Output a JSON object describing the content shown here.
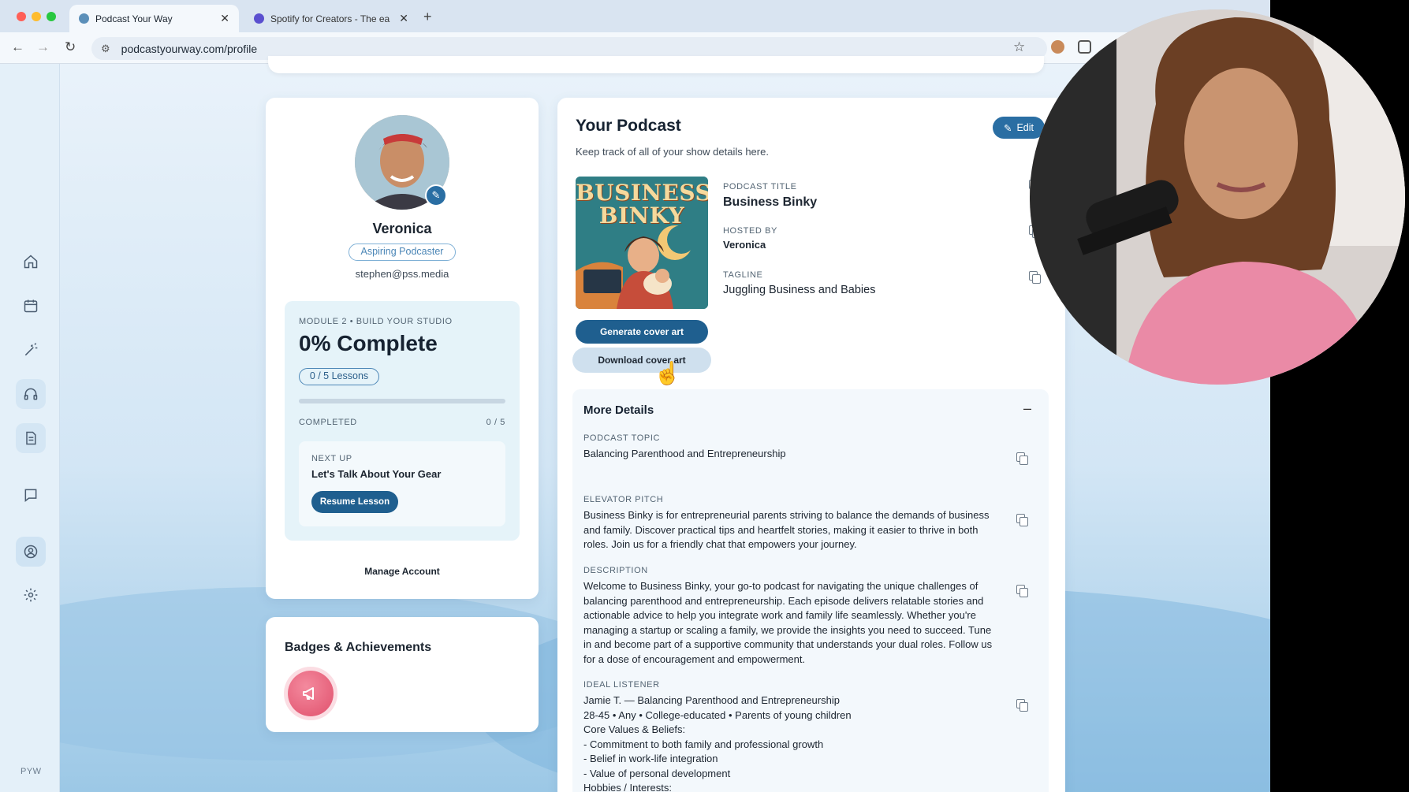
{
  "browser": {
    "tabs": [
      {
        "title": "Podcast Your Way",
        "active": true
      },
      {
        "title": "Spotify for Creators - The ea",
        "active": false
      }
    ],
    "url": "podcastyourway.com/profile"
  },
  "sidebar": {
    "items": [
      "home",
      "calendar",
      "magic-wand",
      "headphones",
      "document",
      "chat",
      "profile",
      "settings"
    ],
    "active": "profile",
    "footer": "PYW"
  },
  "profile": {
    "name": "Veronica",
    "role": "Aspiring Podcaster",
    "email": "stephen@pss.media",
    "module": {
      "label": "MODULE 2 • BUILD YOUR STUDIO",
      "percent_label": "0% Complete",
      "progress": 0,
      "lessons": "0 / 5 Lessons",
      "completed_label": "COMPLETED",
      "completed_count": "0 / 5",
      "next_up_label": "NEXT UP",
      "next_up_title": "Let's Talk About Your Gear",
      "resume_label": "Resume Lesson"
    },
    "manage_label": "Manage Account"
  },
  "badges": {
    "title": "Badges & Achievements"
  },
  "podcast": {
    "heading": "Your Podcast",
    "subheading": "Keep track of all of your show details here.",
    "edit_label": "Edit",
    "cover_text": "BUSINESS BINKY",
    "generate_label": "Generate cover art",
    "download_label": "Download cover art",
    "title_label": "PODCAST TITLE",
    "title": "Business Binky",
    "host_label": "HOSTED BY",
    "host": "Veronica",
    "tagline_label": "TAGLINE",
    "tagline": "Juggling Business and Babies",
    "more_details": {
      "title": "More Details",
      "collapse_symbol": "–",
      "topic_label": "PODCAST TOPIC",
      "topic": "Balancing Parenthood and Entrepreneurship",
      "pitch_label": "ELEVATOR PITCH",
      "pitch": "Business Binky is for entrepreneurial parents striving to balance the demands of business and family. Discover practical tips and heartfelt stories, making it easier to thrive in both roles. Join us for a friendly chat that empowers your journey.",
      "description_label": "DESCRIPTION",
      "description": "Welcome to Business Binky, your go-to podcast for navigating the unique challenges of balancing parenthood and entrepreneurship. Each episode delivers relatable stories and actionable advice to help you integrate work and family life seamlessly. Whether you're managing a startup or scaling a family, we provide the insights you need to succeed. Tune in and become part of a supportive community that understands your dual roles. Follow us for a dose of encouragement and empowerment.",
      "listener_label": "IDEAL LISTENER",
      "listener": "Jamie T. — Balancing Parenthood and Entrepreneurship\n28-45 • Any • College-educated • Parents of young children\nCore Values & Beliefs:\n- Commitment to both family and professional growth\n- Belief in work-life integration\n- Value of personal development\nHobbies / Interests:"
    }
  }
}
